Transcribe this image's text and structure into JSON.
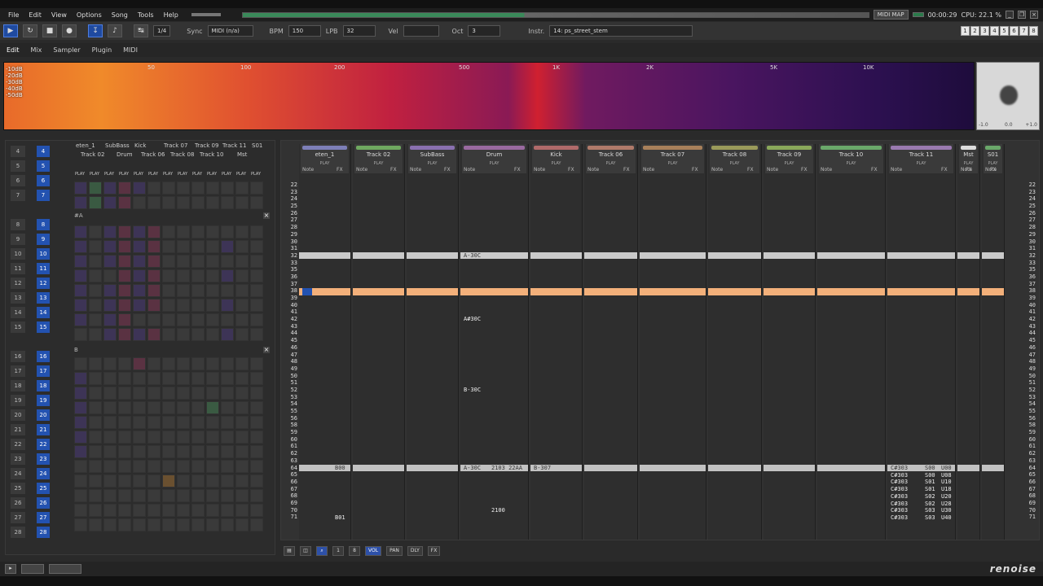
{
  "menu": [
    "File",
    "Edit",
    "View",
    "Options",
    "Song",
    "Tools",
    "Help"
  ],
  "status_right": {
    "midimap": "MIDI MAP",
    "time": "00:00:29",
    "cpu": "CPU: 22.1 %"
  },
  "toolbar": {
    "pattern_step": "1/4",
    "sync_label": "Sync",
    "sync_value": "MIDI (n/a)",
    "bpm_label": "BPM",
    "bpm_value": "150",
    "lpb_label": "LPB",
    "lpb_value": "32",
    "vel_label": "Vel",
    "oct_label": "Oct",
    "oct_value": "3",
    "instr_label": "Instr.",
    "instr_value": "14: ps_street_stem",
    "presets": [
      "1",
      "2",
      "3",
      "4",
      "5",
      "6",
      "7",
      "8"
    ]
  },
  "tabs": [
    "Edit",
    "Mix",
    "Sampler",
    "Plugin",
    "MIDI"
  ],
  "spectrum": {
    "db_labels": [
      "-10dB",
      "-20dB",
      "-30dB",
      "-40dB",
      "-50dB"
    ],
    "freq_labels": [
      "50",
      "100",
      "200",
      "500",
      "1K",
      "2K",
      "5K",
      "10K"
    ]
  },
  "scope_labels": [
    "-1.0",
    "0.0",
    "+1.0"
  ],
  "sequence": [
    "4",
    "5",
    "6",
    "7",
    "",
    "8",
    "9",
    "10",
    "11",
    "12",
    "13",
    "14",
    "15",
    "",
    "16",
    "17",
    "18",
    "19",
    "20",
    "21",
    "22",
    "23",
    "24",
    "25",
    "26",
    "27",
    "28"
  ],
  "matrix_header_top": [
    "eten_1",
    "SubBass",
    "Kick",
    "Track 07",
    "Track 09",
    "Track 11",
    "S01"
  ],
  "matrix_header_bottom": [
    "Track 02",
    "Drum",
    "Track 06",
    "Track 08",
    "Track 10",
    "Mst"
  ],
  "matrix_sections": [
    "#A",
    "B"
  ],
  "play_label": "PLAY",
  "tracks": [
    {
      "name": "eten_1",
      "color": "#7d7fb8"
    },
    {
      "name": "Track 02",
      "color": "#6fa860"
    },
    {
      "name": "SubBass",
      "color": "#8a70b0"
    },
    {
      "name": "Drum",
      "color": "#9a6aa0"
    },
    {
      "name": "Kick",
      "color": "#b06a6a"
    },
    {
      "name": "Track 06",
      "color": "#b07a6a"
    },
    {
      "name": "Track 07",
      "color": "#a8805a"
    },
    {
      "name": "Track 08",
      "color": "#9a9a5a"
    },
    {
      "name": "Track 09",
      "color": "#8aa85a"
    },
    {
      "name": "Track 10",
      "color": "#6aa86a"
    },
    {
      "name": "Track 11",
      "color": "#9a7ab0"
    },
    {
      "name": "Mst",
      "color": "#dddddd"
    },
    {
      "name": "S01",
      "color": "#6aa86a"
    }
  ],
  "col_sub": {
    "note": "Note",
    "fx": "FX"
  },
  "rows": [
    "22",
    "23",
    "24",
    "25",
    "26",
    "27",
    "28",
    "29",
    "30",
    "31",
    "32",
    "33",
    "35",
    "36",
    "37",
    "38",
    "39",
    "40",
    "41",
    "42",
    "43",
    "44",
    "45",
    "46",
    "47",
    "48",
    "49",
    "50",
    "51",
    "52",
    "53",
    "54",
    "55",
    "56",
    "58",
    "59",
    "60",
    "61",
    "62",
    "63",
    "64",
    "65",
    "66",
    "67",
    "68",
    "69",
    "70",
    "71"
  ],
  "pattern_notes": {
    "drum_32": "A-30C",
    "drum_42": "A#30C",
    "drum_52": "B-30C",
    "drum_64": "A-30C",
    "drum_64_fx": "2103 22AA",
    "drum_70_fx": "2100",
    "kick_64": "B-307",
    "eten_64": "B00",
    "eten_71": "B01",
    "t11_notes": [
      "C#303",
      "C#303",
      "C#303",
      "C#303",
      "C#303",
      "C#303",
      "C#303",
      "C#303"
    ],
    "t11_fx": [
      "S00",
      "S00",
      "S01",
      "S01",
      "S02",
      "S02",
      "S03",
      "S03"
    ],
    "t11_fx2": [
      "U00",
      "U08",
      "U10",
      "U18",
      "U20",
      "U28",
      "U30",
      "U40"
    ]
  },
  "bottom": {
    "step": "1",
    "edit_step": "8",
    "vol": "VOL",
    "pan": "PAN",
    "dly": "DLY",
    "fx": "FX"
  },
  "logo": "renoise"
}
